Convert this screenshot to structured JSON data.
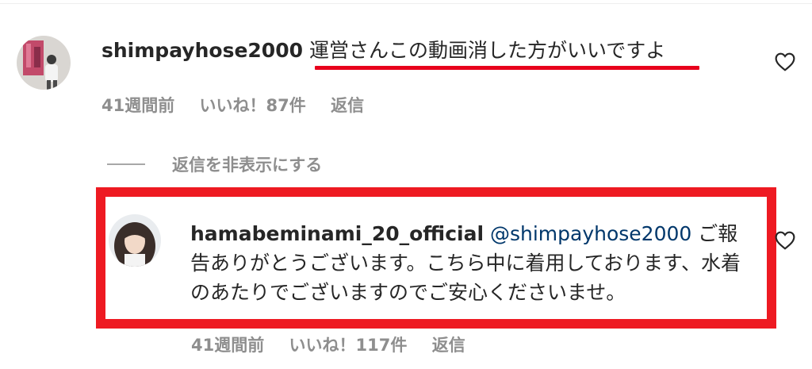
{
  "comment": {
    "username": "shimpayhose2000",
    "text": "運営さんこの動画消した方がいいですよ",
    "time": "41週間前",
    "likes": "いいね！87件",
    "reply_label": "返信"
  },
  "hide_replies_label": "返信を非表示にする",
  "reply": {
    "username": "hamabeminami_20_official",
    "mention": "@shimpayhose2000",
    "text": "ご報告ありがとうございます。こちら中に着用しております、水着のあたりでございますのでご安心くださいませ。",
    "time": "41週間前",
    "likes": "いいね！117件",
    "reply_label": "返信"
  },
  "colors": {
    "highlight_red": "#ee1a22",
    "underline_red": "#e8001c",
    "mention_blue": "#00376b",
    "meta_gray": "#8e8e8e"
  }
}
